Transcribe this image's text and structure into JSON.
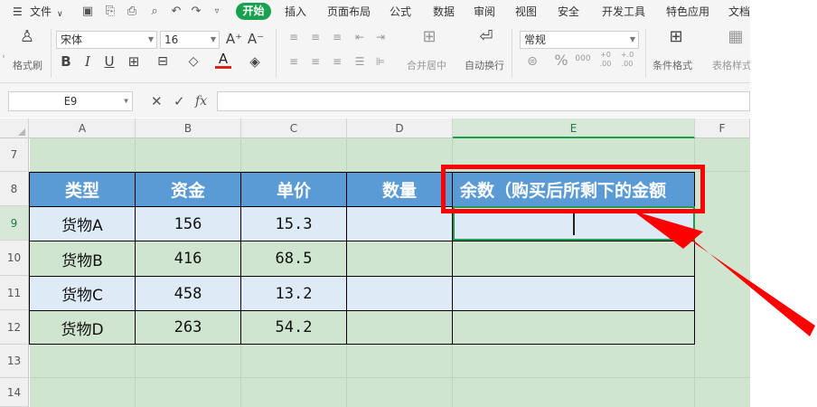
{
  "menu": {
    "file_label": "文件",
    "tabs": [
      "开始",
      "插入",
      "页面布局",
      "公式",
      "数据",
      "审阅",
      "视图",
      "安全",
      "开发工具",
      "特色应用",
      "文档"
    ],
    "active_tab": "开始"
  },
  "ribbon": {
    "format_painter_label": "格式刷",
    "font_name": "宋体",
    "font_size": "16",
    "grow_font_label": "A⁺",
    "shrink_font_label": "A⁻",
    "bold_label": "B",
    "italic_label": "I",
    "underline_label": "U",
    "font_color_label": "A",
    "merge_center_label": "合并居中",
    "wrap_text_label": "自动换行",
    "number_format": "常规",
    "percent_label": "%",
    "thousands_label": "000",
    "inc_decimal_label": "+0 .00",
    "dec_decimal_label": "+.0 .00",
    "conditional_format_label": "条件格式",
    "table_style_label": "表格样式"
  },
  "formula_bar": {
    "cell_reference": "E9",
    "cancel_label": "✕",
    "confirm_label": "✓",
    "fx_label": "fx",
    "formula": ""
  },
  "grid": {
    "columns": [
      "A",
      "B",
      "C",
      "D",
      "E",
      "F"
    ],
    "selected_column": "E",
    "rows": [
      "7",
      "8",
      "9",
      "10",
      "11",
      "12",
      "13",
      "14"
    ],
    "selected_row": "9"
  },
  "table": {
    "headers": [
      "类型",
      "资金",
      "单价",
      "数量",
      "余数（购买后所剩下的金额"
    ],
    "rows": [
      [
        "货物A",
        "156",
        "15.3",
        "",
        ""
      ],
      [
        "货物B",
        "416",
        "68.5",
        "",
        ""
      ],
      [
        "货物C",
        "458",
        "13.2",
        "",
        ""
      ],
      [
        "货物D",
        "263",
        "54.2",
        "",
        ""
      ]
    ]
  },
  "colors": {
    "header_fill": "#5b9bd5",
    "light_row_fill": "#deebf7",
    "sheet_background": "#cfe5cf",
    "accent_green": "#1aa14f",
    "annotation_red": "#ff0000"
  }
}
